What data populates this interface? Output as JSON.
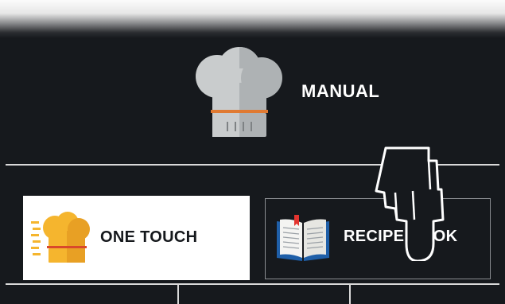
{
  "manual": {
    "label": "MANUAL",
    "icon": "chef-hat-icon"
  },
  "modes": [
    {
      "label": "ONE TOUCH",
      "icon": "chef-hat-motion-icon",
      "selected": true
    },
    {
      "label": "RECIPE BOOK",
      "icon": "open-book-icon",
      "selected": false
    }
  ],
  "colors": {
    "background": "#16191d",
    "selected_tab": "#ffffff",
    "accent_orange": "#e07a32",
    "accent_yellow": "#f5b52e",
    "book_blue": "#1f5fa8",
    "bookmark_red": "#e3342f"
  },
  "pointer": "hand-pointer-icon"
}
